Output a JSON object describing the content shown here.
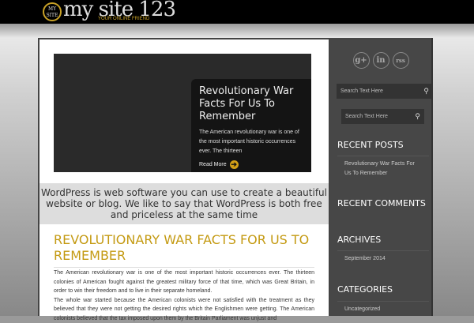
{
  "header": {
    "logo_badge": "MY SITE",
    "site_name": "my site 123",
    "tagline": "YOUR ONLINE FRIEND"
  },
  "slider": {
    "title": "Revolutionary War Facts For Us To Remember",
    "excerpt": "The American revolutionary war is one of the most important historic occurrences ever. The thirteen",
    "read_more": "Read More"
  },
  "band_text": "WordPress is web software you can use to create a beautiful website or blog. We like to say that WordPress is both free and priceless at the same time",
  "post": {
    "title": "REVOLUTIONARY WAR FACTS FOR US TO REMEMBER",
    "paragraphs": [
      "The American revolutionary war is one of the most important historic occurrences ever. The thirteen colonies of American fought against the greatest military force of that time, which was Great Britain, in order to win their freedom and to live in their separate homeland.",
      "The whole war started because the American colonists were not satisfied with the treatment as they believed that they were not getting the desired rights which the Englishmen were getting. The American colonists believed that the tax imposed upon them by the Britain Parliament was unjust and"
    ]
  },
  "sidebar": {
    "social": [
      "g+",
      "in",
      "rss"
    ],
    "search1_placeholder": "Search Text Here",
    "search2_placeholder": "Search Text Here",
    "recent_posts": {
      "title": "RECENT POSTS",
      "items": [
        "Revolutionary War Facts For Us To Remember"
      ]
    },
    "recent_comments": {
      "title": "RECENT COMMENTS"
    },
    "archives": {
      "title": "ARCHIVES",
      "items": [
        "September 2014"
      ]
    },
    "categories": {
      "title": "CATEGORIES",
      "items": [
        "Uncategorized"
      ]
    }
  }
}
